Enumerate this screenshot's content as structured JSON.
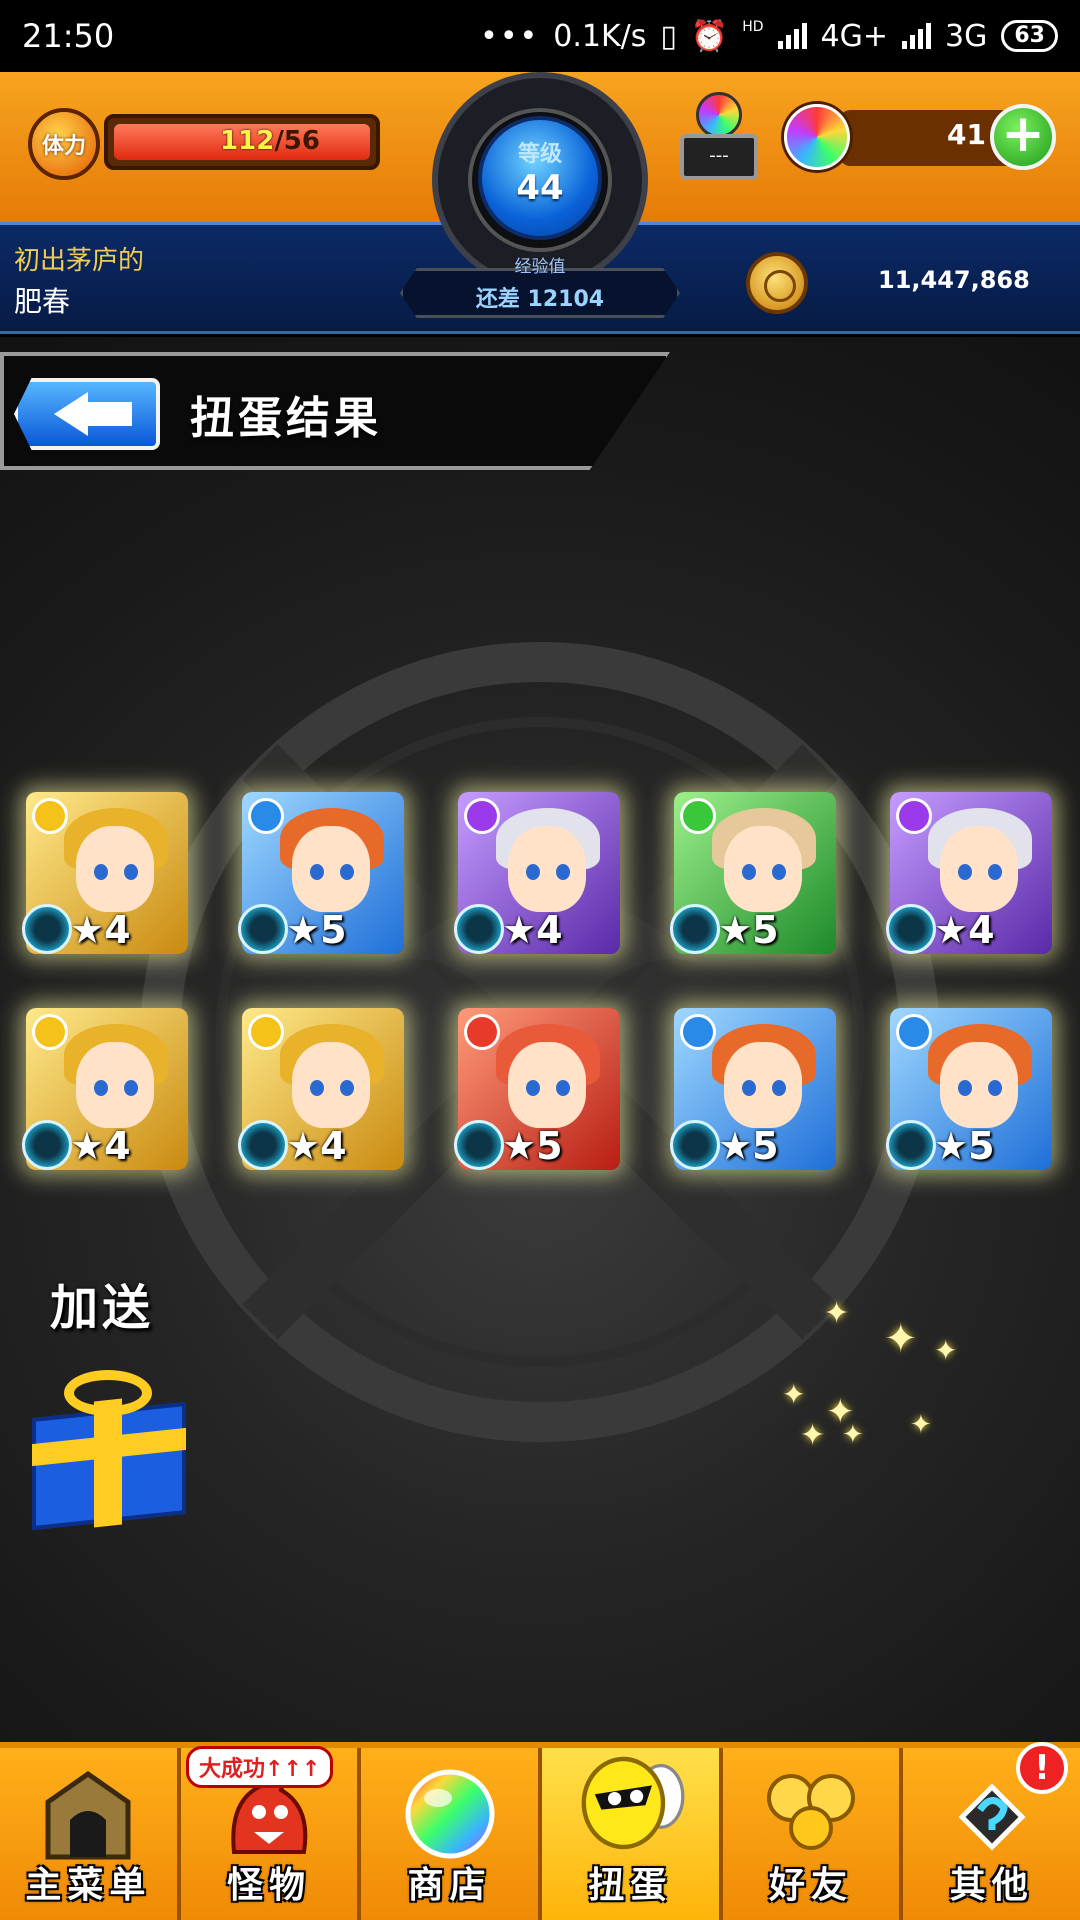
{
  "status_bar": {
    "time": "21:50",
    "dots": "•••",
    "net_speed": "0.1K/s",
    "hd": "HD",
    "network1": "4G+",
    "network2": "3G",
    "battery": "63"
  },
  "header": {
    "stamina_icon": "体力",
    "stamina_current": "112",
    "stamina_max": "/56",
    "level_label": "等级",
    "level": "44",
    "exp_label": "经验值",
    "exp_remaining": "还差 12104",
    "box_value": "---",
    "orb_count": "41",
    "add_label": "+",
    "player_title": "初出茅庐的",
    "player_name": "肥春",
    "coins": "11,447,868"
  },
  "page": {
    "title": "扭蛋结果",
    "bonus_label": "加送"
  },
  "results": [
    {
      "stars": "★4",
      "theme": "gold",
      "attr": "light"
    },
    {
      "stars": "★5",
      "theme": "blue",
      "attr": "water"
    },
    {
      "stars": "★4",
      "theme": "purple",
      "attr": "dark"
    },
    {
      "stars": "★5",
      "theme": "green",
      "attr": "wood"
    },
    {
      "stars": "★4",
      "theme": "purple",
      "attr": "dark"
    },
    {
      "stars": "★4",
      "theme": "gold",
      "attr": "light"
    },
    {
      "stars": "★4",
      "theme": "gold",
      "attr": "light"
    },
    {
      "stars": "★5",
      "theme": "red",
      "attr": "fire"
    },
    {
      "stars": "★5",
      "theme": "blue",
      "attr": "water"
    },
    {
      "stars": "★5",
      "theme": "blue",
      "attr": "water"
    }
  ],
  "nav": {
    "promo_badge": "大成功↑↑↑",
    "alert_badge": "!",
    "items": [
      {
        "label": "主菜单",
        "icon": "home-gate-icon"
      },
      {
        "label": "怪物",
        "icon": "monster-icon"
      },
      {
        "label": "商店",
        "icon": "rainbow-orb-icon"
      },
      {
        "label": "扭蛋",
        "icon": "egg-icon"
      },
      {
        "label": "好友",
        "icon": "friends-balloon-icon"
      },
      {
        "label": "其他",
        "icon": "other-icon"
      }
    ]
  },
  "colors": {
    "header_orange": "#f8a420",
    "header_blue": "#0b2a66",
    "nav_yellow": "#ffc81a",
    "glow": "#ffffaa"
  }
}
